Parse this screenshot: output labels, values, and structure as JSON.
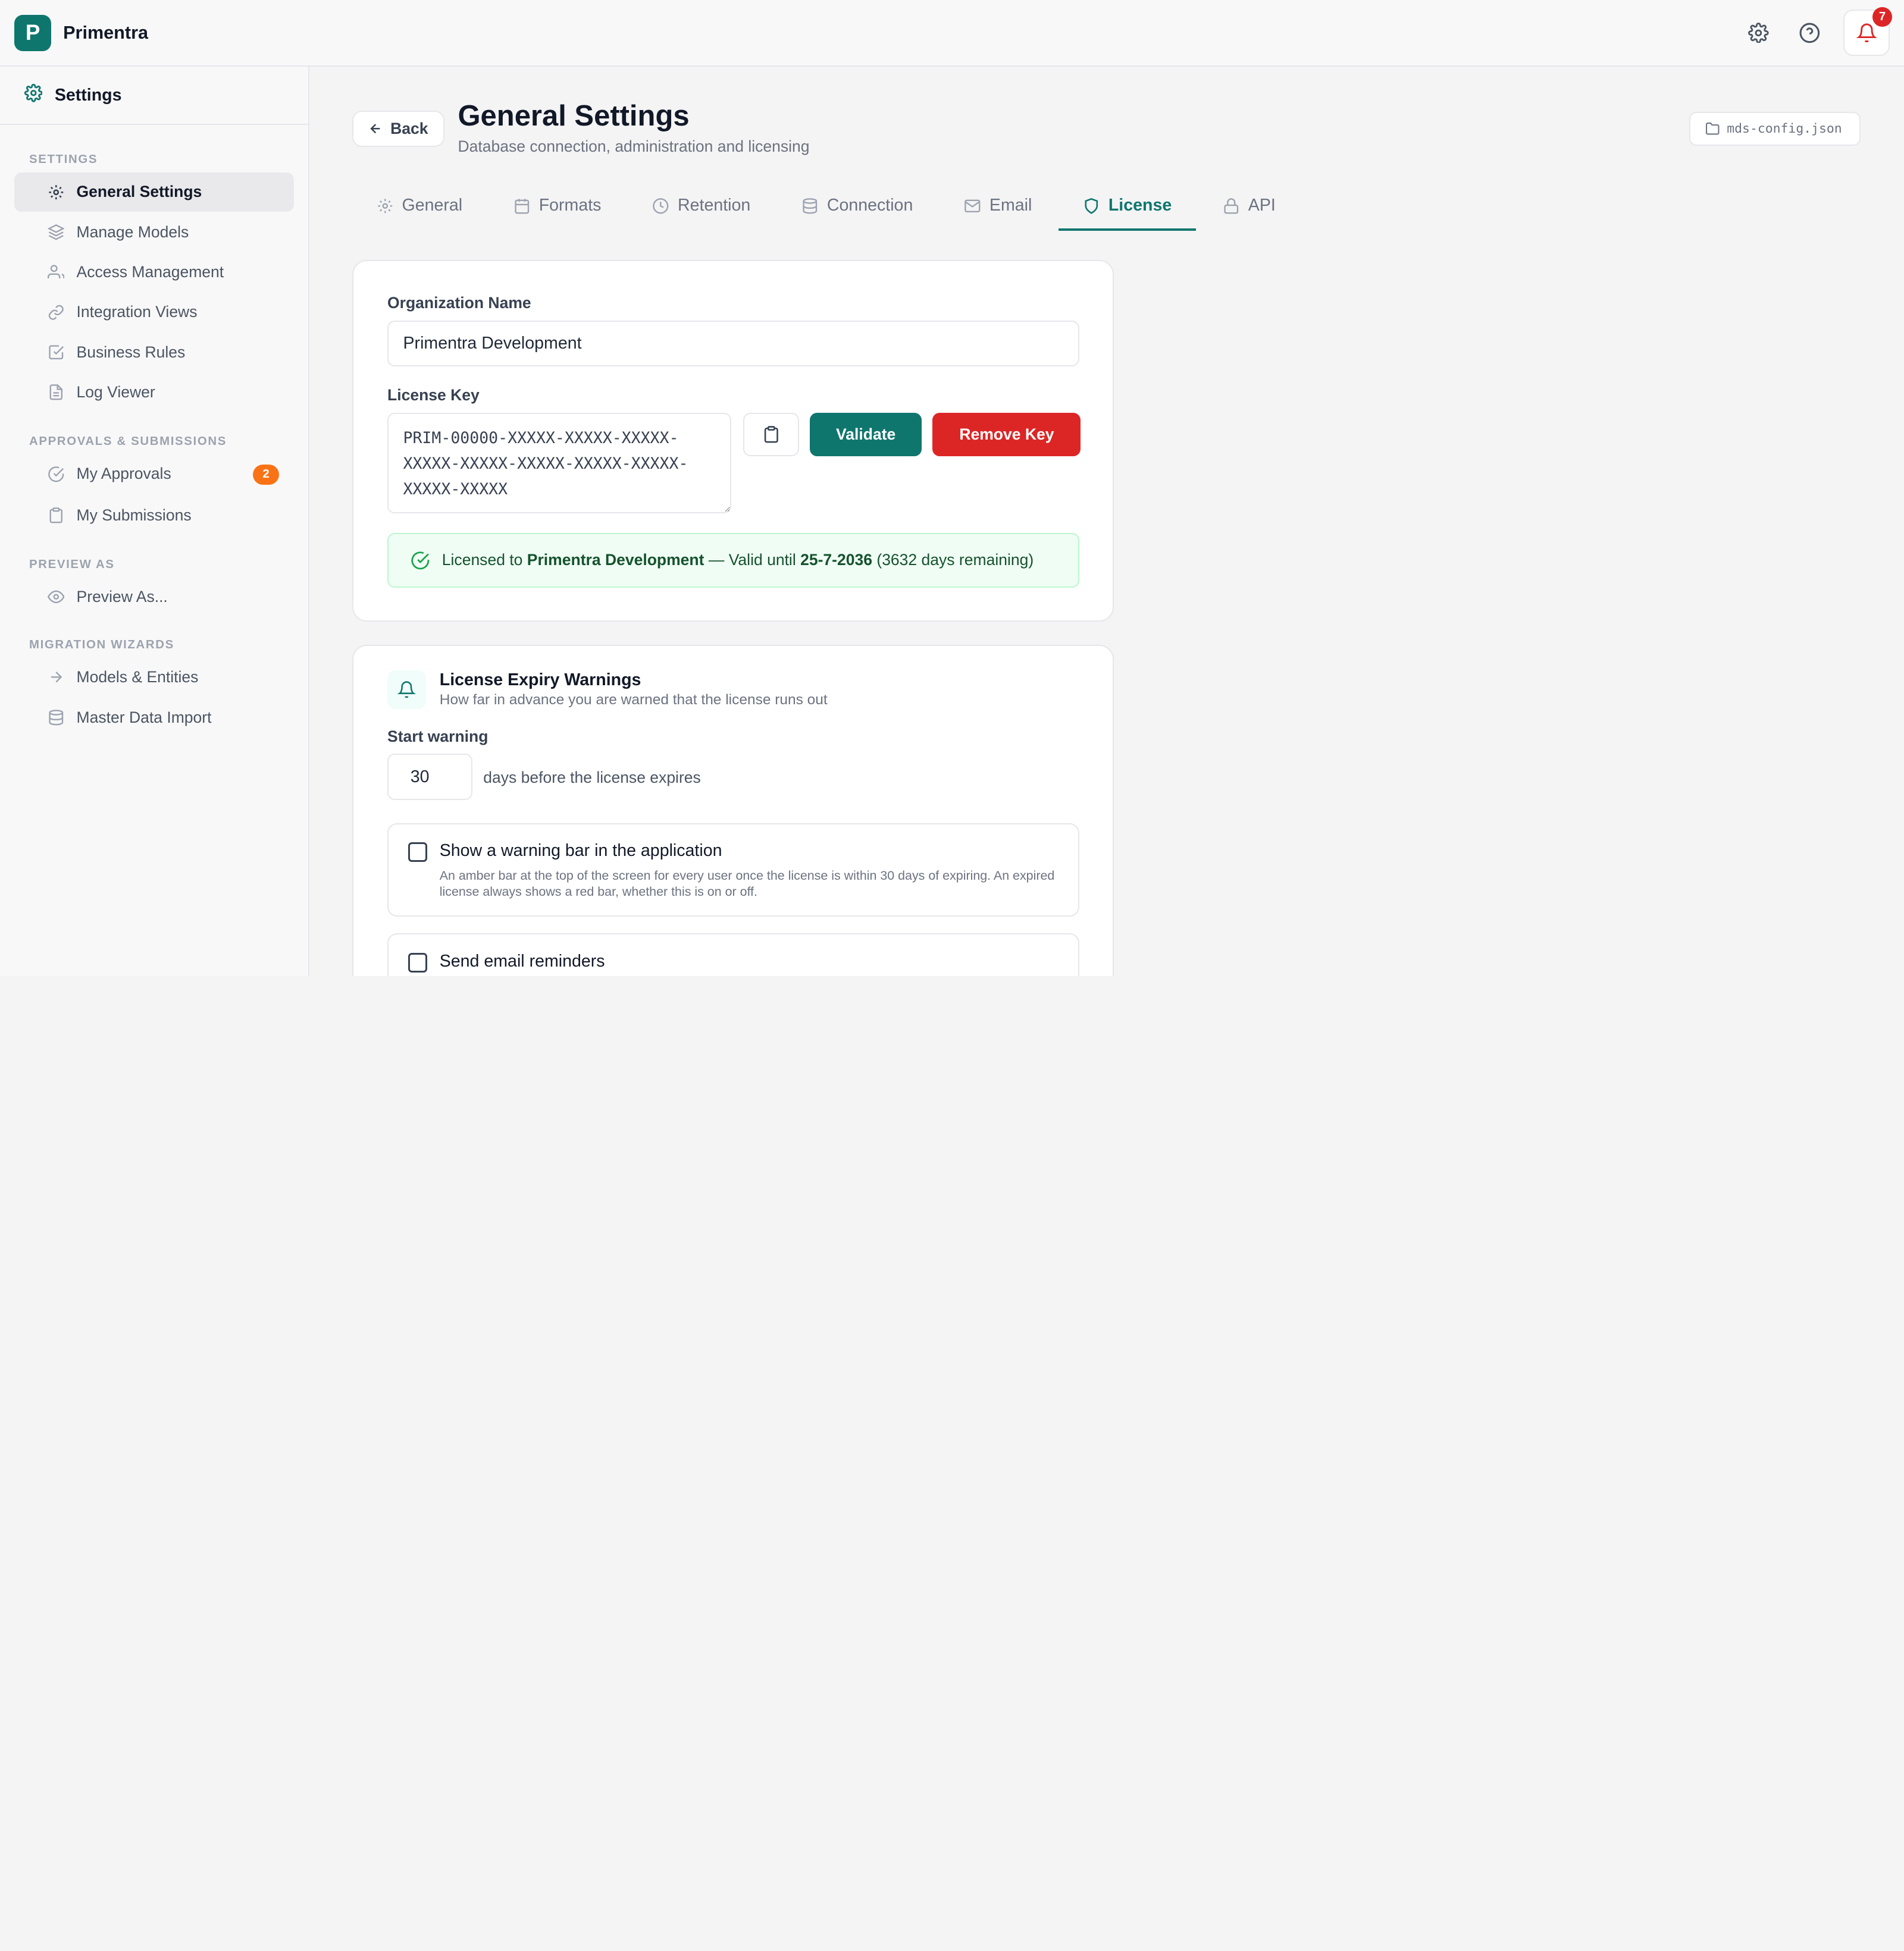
{
  "app": {
    "logo_letter": "P",
    "name": "Primentra",
    "notification_count": "7",
    "colors": {
      "accent": "#0f766e",
      "danger": "#dc2626",
      "badge": "#f97316",
      "success_bg": "#f0fdf4"
    }
  },
  "sidebar": {
    "title": "Settings",
    "sections": [
      {
        "label": "SETTINGS",
        "items": [
          {
            "label": "General Settings",
            "icon": "gear-icon",
            "active": true
          },
          {
            "label": "Manage Models",
            "icon": "layers-icon"
          },
          {
            "label": "Access Management",
            "icon": "users-icon"
          },
          {
            "label": "Integration Views",
            "icon": "link-icon"
          },
          {
            "label": "Business Rules",
            "icon": "check-square-icon"
          },
          {
            "label": "Log Viewer",
            "icon": "file-text-icon"
          }
        ]
      },
      {
        "label": "APPROVALS & SUBMISSIONS",
        "items": [
          {
            "label": "My Approvals",
            "icon": "check-circle-icon",
            "badge": "2"
          },
          {
            "label": "My Submissions",
            "icon": "clipboard-icon"
          }
        ]
      },
      {
        "label": "PREVIEW AS",
        "items": [
          {
            "label": "Preview As...",
            "icon": "eye-icon"
          }
        ]
      },
      {
        "label": "MIGRATION WIZARDS",
        "items": [
          {
            "label": "Models & Entities",
            "icon": "arrow-right-icon"
          },
          {
            "label": "Master Data Import",
            "icon": "database-icon"
          }
        ]
      }
    ]
  },
  "header": {
    "back_label": "Back",
    "title": "General Settings",
    "subtitle": "Database connection, administration and licensing",
    "config_file": "mds-config.json"
  },
  "tabs": [
    {
      "label": "General",
      "icon": "gear-icon"
    },
    {
      "label": "Formats",
      "icon": "calendar-icon"
    },
    {
      "label": "Retention",
      "icon": "clock-icon"
    },
    {
      "label": "Connection",
      "icon": "database-icon"
    },
    {
      "label": "Email",
      "icon": "mail-icon"
    },
    {
      "label": "License",
      "icon": "shield-icon",
      "active": true
    },
    {
      "label": "API",
      "icon": "lock-icon"
    }
  ],
  "license": {
    "org_label": "Organization Name",
    "org_value": "Primentra Development",
    "key_label": "License Key",
    "key_value": "PRIM-00000-XXXXX-XXXXX-XXXXX-XXXXX-XXXXX-XXXXX-XXXXX-XXXXX-XXXXX-XXXXX",
    "validate_label": "Validate",
    "remove_label": "Remove Key",
    "status_prefix": "Licensed to",
    "status_org": "Primentra Development",
    "status_mid": "— Valid until",
    "status_date": "25-7-2036",
    "status_suffix": "(3632 days remaining)"
  },
  "expiry": {
    "title": "License Expiry Warnings",
    "subtitle": "How far in advance you are warned that the license runs out",
    "start_label": "Start warning",
    "days_value": "30",
    "days_suffix": "days before the license expires",
    "options": [
      {
        "title": "Show a warning bar in the application",
        "desc": "An amber bar at the top of the screen for every user once the license is within 30 days of expiring. An expired license always shows a red bar, whether this is on or off.",
        "checked": false
      },
      {
        "title": "Send email reminders",
        "desc": "",
        "checked": false
      }
    ]
  }
}
